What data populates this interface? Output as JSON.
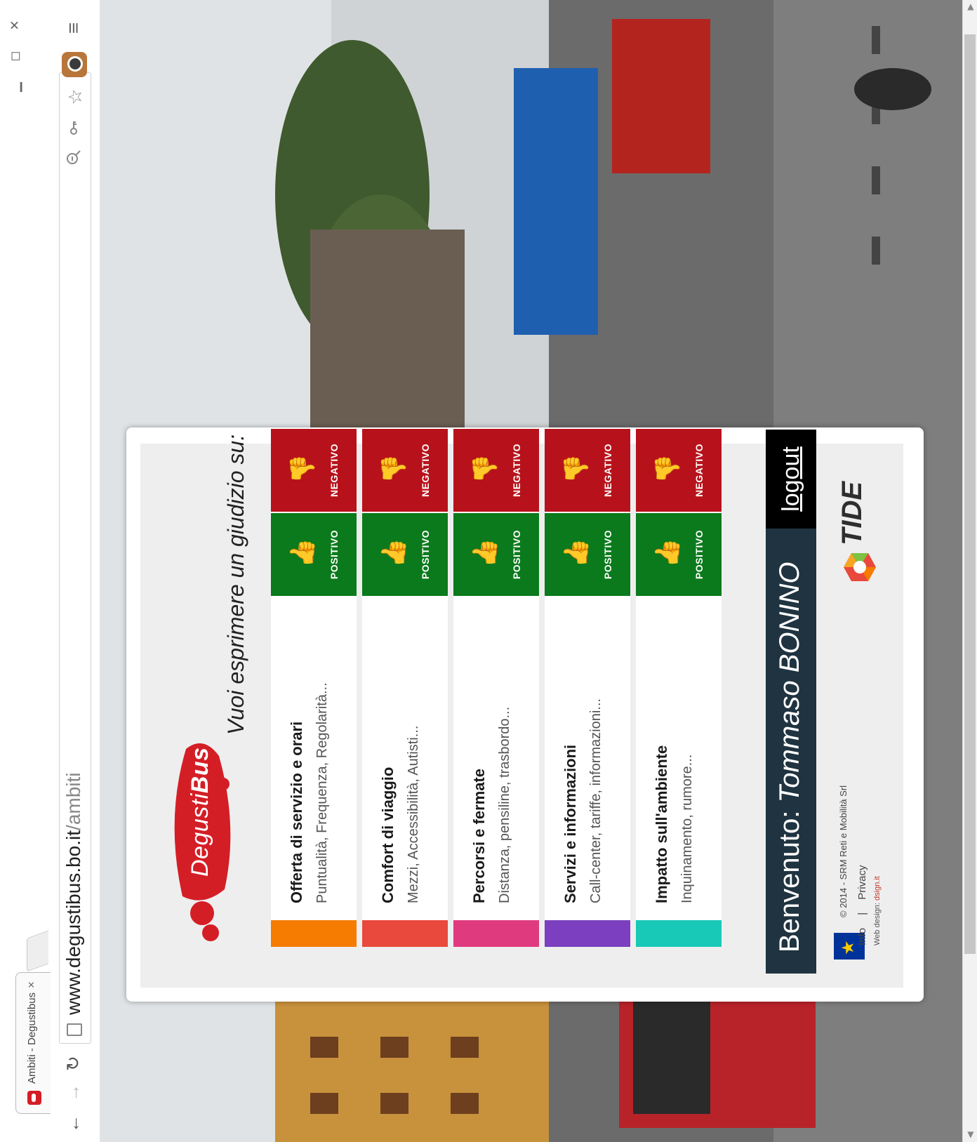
{
  "browser": {
    "tab_title": "Ambiti - Degustibus",
    "tab_close": "×",
    "url_host": "www.degustibus.bo.it",
    "url_path": "/ambiti",
    "back_icon": "←",
    "forward_icon": "→",
    "reload_icon": "↻",
    "menu_icon": "≡",
    "star_icon": "☆",
    "min_icon": "▁",
    "max_icon": "◻",
    "close_icon": "✕"
  },
  "app": {
    "logo_text_a": "Degusti",
    "logo_text_b": "Bus",
    "prompt": "Vuoi esprimere un giudizio su:",
    "positive_label": "POSITIVO",
    "negative_label": "NEGATIVO",
    "categories": [
      {
        "title": "Offerta di servizio e orari",
        "subtitle": "Puntualità, Frequenza, Regolarità...",
        "color": "#f57c00"
      },
      {
        "title": "Comfort di viaggio",
        "subtitle": "Mezzi, Accessibilità, Autisti...",
        "color": "#e8493c"
      },
      {
        "title": "Percorsi e fermate",
        "subtitle": "Distanza, pensiline, trasbordo...",
        "color": "#e03a7e"
      },
      {
        "title": "Servizi e informazioni",
        "subtitle": "Call-center, tariffe, informazioni...",
        "color": "#7b3fbf"
      },
      {
        "title": "Impatto sull'ambiente",
        "subtitle": "Inquinamento, rumore...",
        "color": "#18c9b8"
      }
    ],
    "welcome_prefix": "Benvenuto: ",
    "user_name": "Tommaso BONINO",
    "logout": "logout",
    "footer": {
      "copyright": "© 2014 - SRM Reti e Mobilità Srl",
      "info": "Info",
      "separator": "|",
      "privacy": "Privacy",
      "design_prefix": "Web design: ",
      "design_name": "dsign.it"
    },
    "partner": "TIDE"
  },
  "colors": {
    "positive": "#0b7a1c",
    "negative": "#b7121b",
    "welcome_bg": "#1f3340",
    "logo_red": "#d41e26"
  }
}
